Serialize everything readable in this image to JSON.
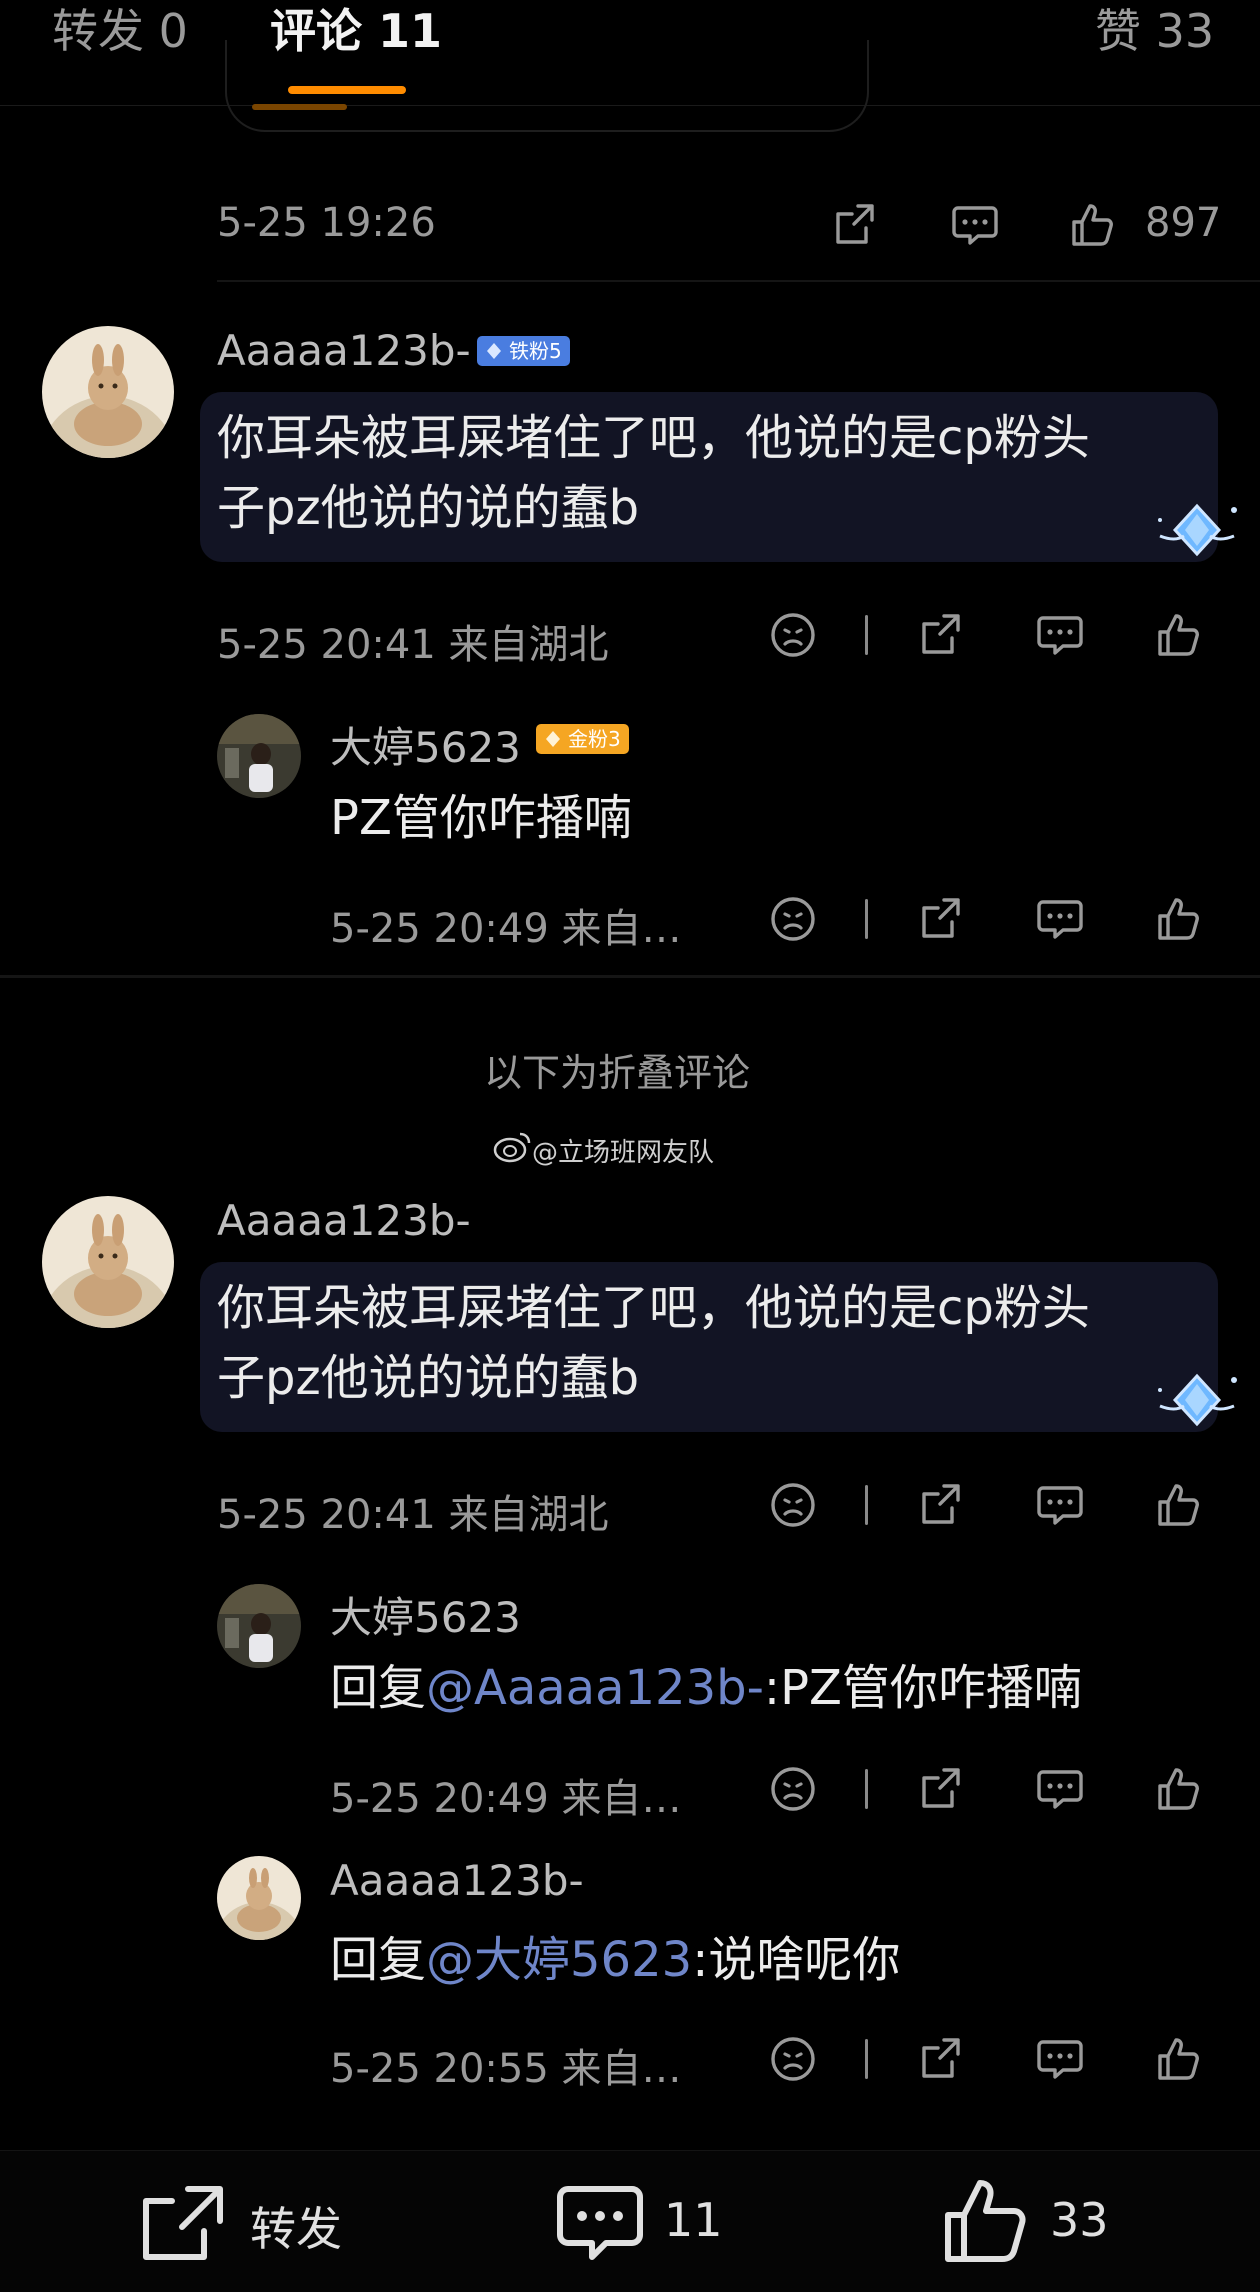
{
  "tabs": [
    {
      "label": "转发 0"
    },
    {
      "label": "评论 11"
    },
    {
      "label": "赞 33"
    }
  ],
  "first_meta": {
    "time": "5-25 19:26",
    "likes": "897"
  },
  "comments": [
    {
      "username": "Aaaaa123b-",
      "badge": "铁粉5",
      "lines": [
        "你耳朵被耳屎堵住了吧，他说的是cp粉头",
        "子pz他说的说的蠢b"
      ],
      "meta": "5-25 20:41  来自湖北",
      "reply": {
        "username": "大婷5623",
        "badge": "金粉3",
        "text": "PZ管你咋播喃",
        "meta": "5-25 20:49  来自…"
      }
    }
  ],
  "folded": {
    "label": "以下为折叠评论",
    "watermark": "@立场班网友队"
  },
  "folded_comment": {
    "username": "Aaaaa123b-",
    "lines": [
      "你耳朵被耳屎堵住了吧，他说的是cp粉头",
      "子pz他说的说的蠢b"
    ],
    "meta": "5-25 20:41  来自湖北",
    "replies": [
      {
        "username": "大婷5623",
        "prefix": "回复",
        "mention": "@Aaaaa123b-",
        "text": ":PZ管你咋播喃",
        "meta": "5-25 20:49  来自…"
      },
      {
        "username": "Aaaaa123b-",
        "prefix": "回复",
        "mention": "@大婷5623",
        "text": ":说啥呢你",
        "meta": "5-25 20:55  来自…"
      }
    ]
  },
  "bottom_bar": {
    "repost_label": "转发",
    "comment_count": "11",
    "like_count": "33"
  },
  "colors": {
    "accent": "#ff8c00",
    "link": "#6f86c9",
    "badge_iron": "#4a7de0",
    "badge_gold": "#f5a623"
  }
}
